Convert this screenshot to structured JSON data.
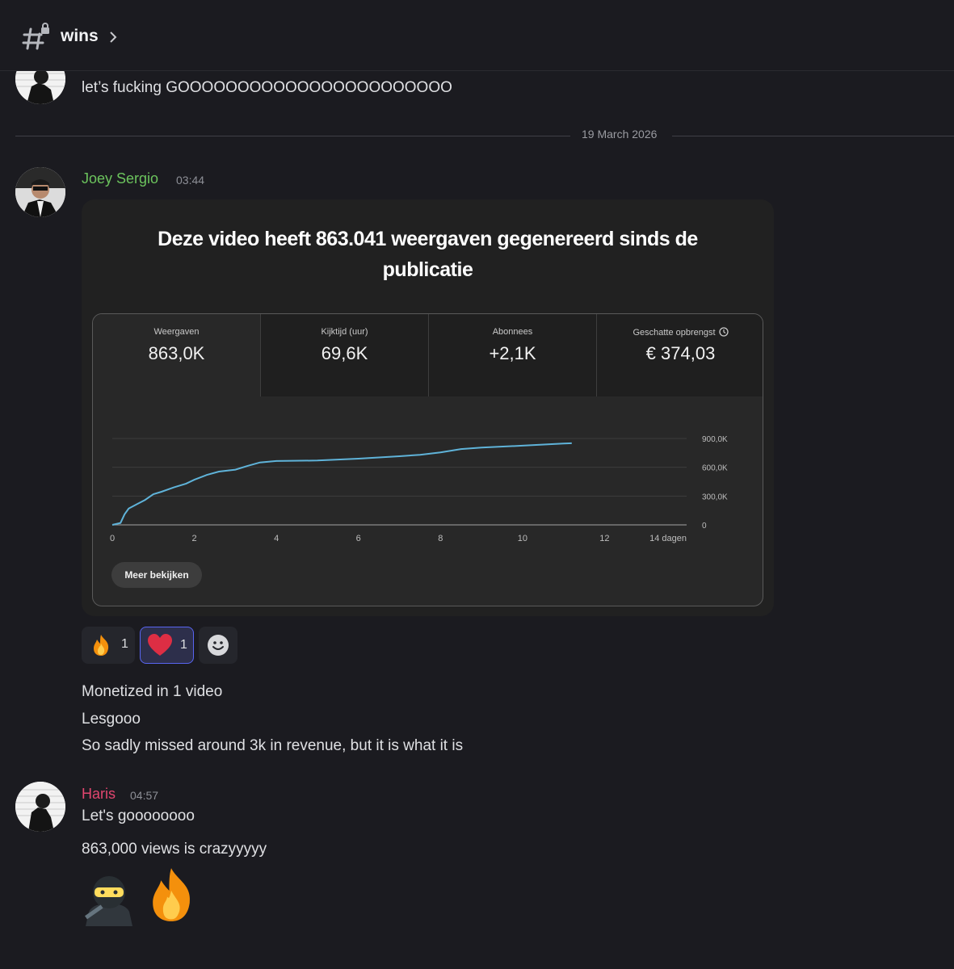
{
  "channel": {
    "name": "wins"
  },
  "top_message": {
    "text": "let’s fucking GOOOOOOOOOOOOOOOOOOOOOOO"
  },
  "date_divider": "19 March 2026",
  "messages": [
    {
      "author": "Joey Sergio",
      "author_color": "#6cc45d",
      "time": "03:44",
      "embed": {
        "title_line1": "Deze video heeft 863.041 weergaven gegenereerd sinds de",
        "title_line2": "publicatie",
        "metrics": [
          {
            "label": "Weergaven",
            "value": "863,0K"
          },
          {
            "label": "Kijktijd (uur)",
            "value": "69,6K"
          },
          {
            "label": "Abonnees",
            "value": "+2,1K"
          },
          {
            "label": "Geschatte opbrengst",
            "value": "€ 374,03"
          }
        ],
        "button_label": "Meer bekijken"
      },
      "reactions": [
        {
          "emoji": "fire-icon",
          "count": "1"
        },
        {
          "emoji": "heart-icon",
          "count": "1",
          "active": true
        }
      ],
      "lines": [
        "Monetized in 1 video",
        "Lesgooo",
        "So sadly missed around 3k in revenue, but it is what it is"
      ]
    },
    {
      "author": "Haris",
      "author_color": "#e2466f",
      "time": "04:57",
      "lines": [
        "Let's goooooooo",
        "863,000 views is crazyyyyy"
      ],
      "emojis": [
        "ninja-icon",
        "fire-icon"
      ]
    }
  ],
  "chart_data": {
    "type": "line",
    "xlabel": "dagen",
    "x_ticks": [
      "0",
      "2",
      "4",
      "6",
      "8",
      "10",
      "12",
      "14 dagen"
    ],
    "y_ticks": [
      "0",
      "300,0K",
      "600,0K",
      "900,0K"
    ],
    "xlim": [
      0,
      14
    ],
    "ylim": [
      0,
      900000
    ],
    "grid": true,
    "series": [
      {
        "color": "#5fb3d9",
        "x": [
          0,
          0.2,
          0.3,
          0.4,
          0.6,
          0.8,
          1.0,
          1.2,
          1.5,
          1.8,
          2.0,
          2.3,
          2.6,
          3.0,
          3.3,
          3.6,
          4.0,
          5.0,
          6.0,
          7.0,
          7.5,
          8.0,
          8.5,
          9.0,
          10.0,
          11.0,
          11.2
        ],
        "y": [
          0,
          20000,
          110000,
          170000,
          215000,
          260000,
          320000,
          345000,
          390000,
          430000,
          470000,
          520000,
          555000,
          575000,
          615000,
          650000,
          665000,
          670000,
          690000,
          715000,
          730000,
          755000,
          790000,
          805000,
          825000,
          848000,
          850000
        ]
      }
    ]
  }
}
